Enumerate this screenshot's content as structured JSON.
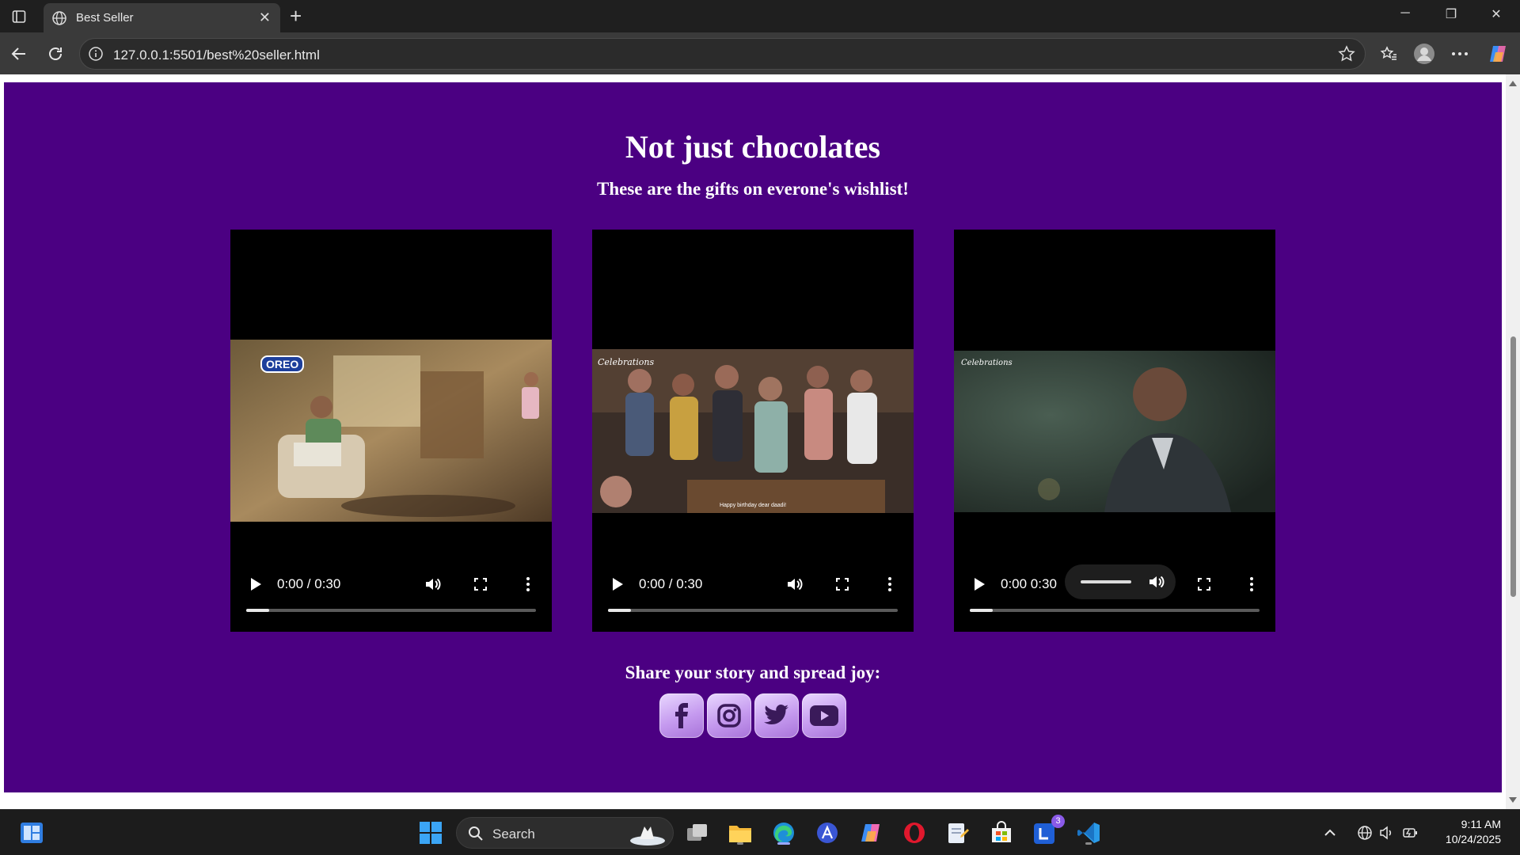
{
  "browser": {
    "tab_title": "Best Seller",
    "url": "127.0.0.1:5501/best%20seller.html"
  },
  "page": {
    "heading": "Not just chocolates",
    "subheading": "These are the gifts on everone's wishlist!",
    "share_text": "Share your story and spread joy:",
    "background_color": "#4b0082",
    "videos": [
      {
        "thumbnail_brand": "OREO",
        "time_label": "0:00 / 0:30",
        "progress": 0.08
      },
      {
        "thumbnail_brand": "Celebrations",
        "caption": "Happy birthday dear daadi!",
        "time_label": "0:00 / 0:30",
        "progress": 0.08
      },
      {
        "thumbnail_brand": "Celebrations",
        "time_label": "0:00 0:30",
        "progress": 0.08
      }
    ],
    "socials": [
      "facebook-icon",
      "instagram-icon",
      "twitter-icon",
      "youtube-icon"
    ]
  },
  "taskbar": {
    "search_placeholder": "Search",
    "time": "9:11 AM",
    "date": "10/24/2025",
    "badge_count": "3"
  }
}
